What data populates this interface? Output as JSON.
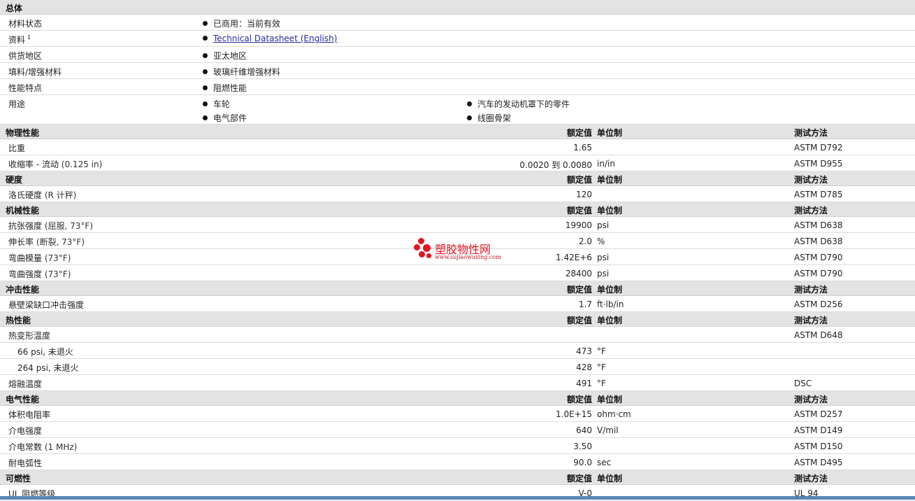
{
  "general": {
    "title": "总体",
    "material_status": {
      "label": "材料状态",
      "value": "已商用：当前有效"
    },
    "docs": {
      "label": "资料",
      "sup": "1",
      "link": "Technical Datasheet (English)"
    },
    "region": {
      "label": "供货地区",
      "value": "亚太地区"
    },
    "filler": {
      "label": "填料/增强材料",
      "value": "玻璃纤维增强材料"
    },
    "features": {
      "label": "性能特点",
      "value": "阻燃性能"
    },
    "uses": {
      "label": "用途",
      "items": [
        "车轮",
        "汽车的发动机罩下的零件",
        "电气部件",
        "线圈骨架"
      ]
    }
  },
  "headers": {
    "value": "额定值",
    "unit": "单位制",
    "method": "测试方法"
  },
  "sections": [
    {
      "title": "物理性能",
      "rows": [
        {
          "label": "比重",
          "cond": "",
          "value": "1.65",
          "unit": "",
          "method": "ASTM D792"
        },
        {
          "label": "收缩率 - 流动",
          "cond": "(0.125 in)",
          "value": "0.0020 到  0.0080",
          "unit": "in/in",
          "method": "ASTM D955"
        }
      ]
    },
    {
      "title": "硬度",
      "rows": [
        {
          "label": "洛氏硬度",
          "cond": "(R 计秤)",
          "value": "120",
          "unit": "",
          "method": "ASTM D785"
        }
      ]
    },
    {
      "title": "机械性能",
      "rows": [
        {
          "label": "抗张强度",
          "cond": "(屈服, 73°F)",
          "value": "19900",
          "unit": "psi",
          "method": "ASTM D638"
        },
        {
          "label": "伸长率",
          "cond": "(断裂, 73°F)",
          "value": "2.0",
          "unit": "%",
          "method": "ASTM D638"
        },
        {
          "label": "弯曲模量",
          "cond": "(73°F)",
          "value": "1.42E+6",
          "unit": "psi",
          "method": "ASTM D790"
        },
        {
          "label": "弯曲强度",
          "cond": "(73°F)",
          "value": "28400",
          "unit": "psi",
          "method": "ASTM D790"
        }
      ]
    },
    {
      "title": "冲击性能",
      "rows": [
        {
          "label": "悬壁梁缺口冲击强度",
          "cond": "",
          "value": "1.7",
          "unit": "ft·lb/in",
          "method": "ASTM D256"
        }
      ]
    },
    {
      "title": "热性能",
      "rows": [
        {
          "label": "热变形温度",
          "cond": "",
          "value": "",
          "unit": "",
          "method": "ASTM D648"
        },
        {
          "label": "66 psi, 未退火",
          "cond": "",
          "value": "473",
          "unit": "°F",
          "method": "",
          "sub": true
        },
        {
          "label": "264 psi, 未退火",
          "cond": "",
          "value": "428",
          "unit": "°F",
          "method": "",
          "sub": true
        },
        {
          "label": "熔融温度",
          "cond": "",
          "value": "491",
          "unit": "°F",
          "method": "DSC"
        }
      ]
    },
    {
      "title": "电气性能",
      "rows": [
        {
          "label": "体积电阻率",
          "cond": "",
          "value": "1.0E+15",
          "unit": "ohm·cm",
          "method": "ASTM D257"
        },
        {
          "label": "介电强度",
          "cond": "",
          "value": "640",
          "unit": "V/mil",
          "method": "ASTM D149"
        },
        {
          "label": "介电常数",
          "cond": "(1 MHz)",
          "value": "3.50",
          "unit": "",
          "method": "ASTM D150"
        },
        {
          "label": "耐电弧性",
          "cond": "",
          "value": "90.0",
          "unit": "sec",
          "method": "ASTM D495"
        }
      ]
    },
    {
      "title": "可燃性",
      "rows": [
        {
          "label": "UL 阻燃等级",
          "cond": "",
          "value": "V-0",
          "unit": "",
          "method": "UL 94"
        }
      ]
    }
  ],
  "watermark": {
    "name": "塑胶物性网",
    "url": "www.sujiaowuxing.com"
  },
  "colors": {
    "section_bg": "#e3e3e3",
    "link": "#2a2aa0",
    "watermark": "#e0161f",
    "bottom_bar": "#5a86b8"
  }
}
